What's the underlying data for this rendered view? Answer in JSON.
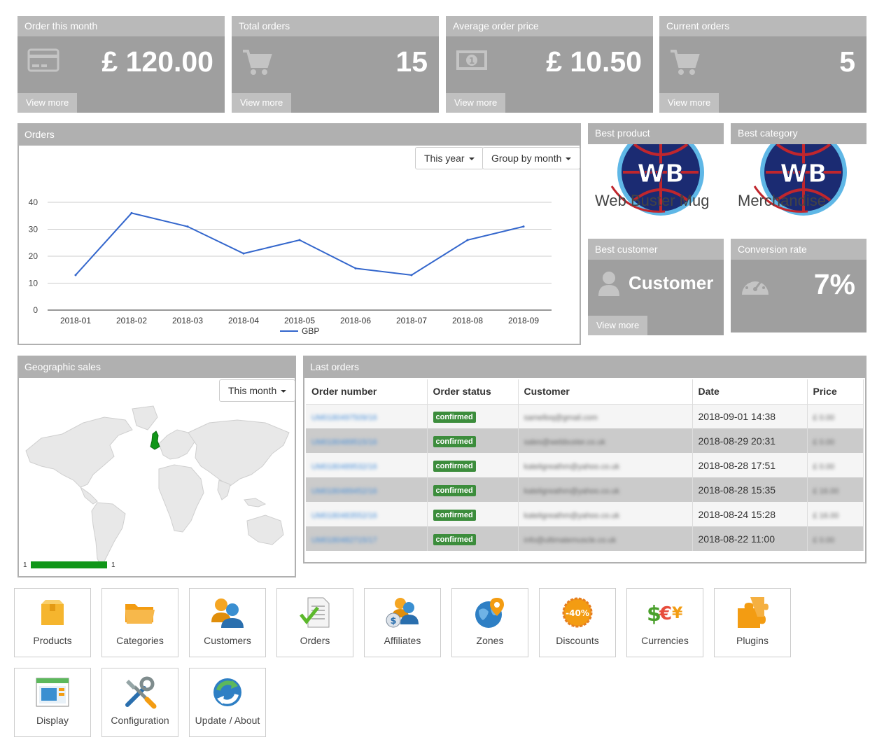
{
  "stats": [
    {
      "label": "Order this month",
      "value": "£ 120.00",
      "link": "View more",
      "icon": "credit-card-icon"
    },
    {
      "label": "Total orders",
      "value": "15",
      "link": "View more",
      "icon": "cart-icon"
    },
    {
      "label": "Average order price",
      "value": "£ 10.50",
      "link": "View more",
      "icon": "money-icon"
    },
    {
      "label": "Current orders",
      "value": "5",
      "link": "View more",
      "icon": "cart-icon"
    }
  ],
  "orders_panel": {
    "title": "Orders",
    "period_dropdown": "This year",
    "group_dropdown": "Group by month"
  },
  "chart_data": {
    "type": "line",
    "categories": [
      "2018-01",
      "2018-02",
      "2018-03",
      "2018-04",
      "2018-05",
      "2018-06",
      "2018-07",
      "2018-08",
      "2018-09"
    ],
    "series": [
      {
        "name": "GBP",
        "values": [
          13,
          36,
          31,
          21,
          26,
          15.5,
          13,
          26,
          31
        ]
      }
    ],
    "yticks": [
      0,
      10,
      20,
      30,
      40
    ],
    "ylim": [
      0,
      40
    ],
    "grid": true,
    "legend_position": "bottom",
    "colors": {
      "line": "#3366cc"
    }
  },
  "best_product": {
    "title": "Best product",
    "name": "Web Buster Mug",
    "logo_text": "WB"
  },
  "best_category": {
    "title": "Best category",
    "name": "Merchandise",
    "logo_text": "WB"
  },
  "best_customer": {
    "title": "Best customer",
    "name": "Customer",
    "link": "View more",
    "icon": "user-icon"
  },
  "conversion": {
    "title": "Conversion rate",
    "value": "7%",
    "icon": "speedometer-icon"
  },
  "geo": {
    "title": "Geographic sales",
    "dropdown": "This month",
    "legend_min": "1",
    "legend_max": "1",
    "legend_color": "#109618"
  },
  "last_orders": {
    "title": "Last orders",
    "columns": [
      "Order number",
      "Order status",
      "Customer",
      "Date",
      "Price"
    ],
    "rows": [
      {
        "number": "UM0180497509/16",
        "status": "confirmed",
        "customer": "samelloq@gmail.com",
        "date": "2018-09-01 14:38",
        "price": "£ 0.00"
      },
      {
        "number": "UM0180489515/16",
        "status": "confirmed",
        "customer": "sales@webbuster.co.uk",
        "date": "2018-08-29 20:31",
        "price": "£ 0.00"
      },
      {
        "number": "UM0180489532/16",
        "status": "confirmed",
        "customer": "kateligreathm@yahoo.co.uk",
        "date": "2018-08-28 17:51",
        "price": "£ 0.00"
      },
      {
        "number": "UM0180489452/16",
        "status": "confirmed",
        "customer": "kateligreathm@yahoo.co.uk",
        "date": "2018-08-28 15:35",
        "price": "£ 16.00"
      },
      {
        "number": "UM0180483552/16",
        "status": "confirmed",
        "customer": "kateligreathm@yahoo.co.uk",
        "date": "2018-08-24 15:28",
        "price": "£ 16.00"
      },
      {
        "number": "UM0180482715/17",
        "status": "confirmed",
        "customer": "info@ultimatemuscle.co.uk",
        "date": "2018-08-22 11:00",
        "price": "£ 0.00"
      }
    ]
  },
  "nav": [
    {
      "label": "Products",
      "icon": "box-icon"
    },
    {
      "label": "Categories",
      "icon": "folder-icon"
    },
    {
      "label": "Customers",
      "icon": "users-icon"
    },
    {
      "label": "Orders",
      "icon": "document-check-icon"
    },
    {
      "label": "Affiliates",
      "icon": "affiliate-icon"
    },
    {
      "label": "Zones",
      "icon": "globe-icon"
    },
    {
      "label": "Discounts",
      "icon": "discount-icon"
    },
    {
      "label": "Currencies",
      "icon": "currency-icon"
    },
    {
      "label": "Plugins",
      "icon": "puzzle-icon"
    },
    {
      "label": "Display",
      "icon": "display-icon"
    },
    {
      "label": "Configuration",
      "icon": "tools-icon"
    },
    {
      "label": "Update / About",
      "icon": "refresh-icon"
    }
  ]
}
